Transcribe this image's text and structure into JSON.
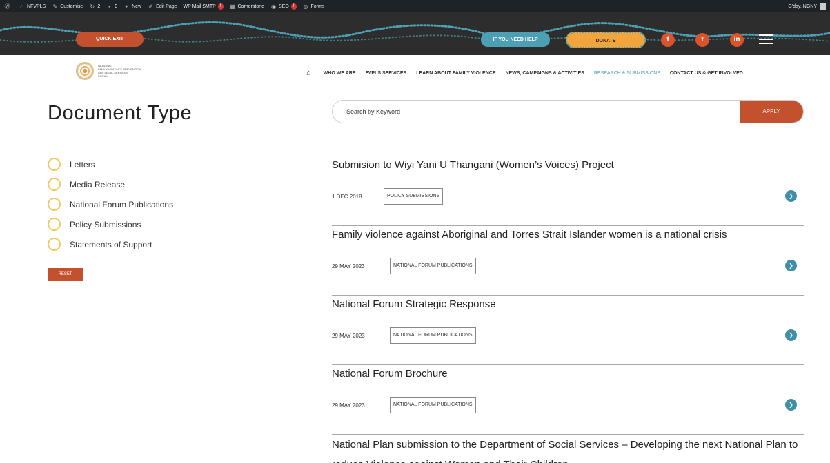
{
  "adminbar": {
    "items": [
      {
        "icon": "wordpress-icon",
        "label": ""
      },
      {
        "icon": "home-icon",
        "label": "NFVPLS"
      },
      {
        "icon": "brush-icon",
        "label": "Customise"
      },
      {
        "icon": "refresh-icon",
        "label": "2"
      },
      {
        "icon": "comment-icon",
        "label": "0"
      },
      {
        "icon": "plus-icon",
        "label": "New"
      },
      {
        "icon": "pencil-icon",
        "label": "Edit Page"
      },
      {
        "icon": "mail-icon",
        "label": "WP Mail SMTP",
        "badge": "!"
      },
      {
        "icon": "cornerstone-icon",
        "label": "Cornerstone"
      },
      {
        "icon": "seo-icon",
        "label": "SEO",
        "badge": "!"
      },
      {
        "icon": "forms-icon",
        "label": "Forms"
      }
    ],
    "greeting": "G'day, NGNY"
  },
  "header": {
    "quick_exit": "QUICK EXIT",
    "help": "IF YOU NEED HELP",
    "donate": "DONATE",
    "social": [
      "f",
      "t",
      "in"
    ]
  },
  "logo": {
    "line1": "NATIONAL",
    "line2": "FAMILY VIOLENCE PREVENTION",
    "line3": "AND LEGAL SERVICES",
    "line4": "FORUM"
  },
  "nav": {
    "items": [
      {
        "label": "WHO WE ARE",
        "active": false
      },
      {
        "label": "FVPLS SERVICES",
        "active": false
      },
      {
        "label": "LEARN ABOUT FAMILY VIOLENCE",
        "active": false
      },
      {
        "label": "NEWS, CAMPAIGNS & ACTIVITIES",
        "active": false
      },
      {
        "label": "RESEARCH & SUBMISSIONS",
        "active": true
      },
      {
        "label": "CONTACT US & GET INVOLVED",
        "active": false
      }
    ]
  },
  "sidebar": {
    "heading": "Document Type",
    "filters": [
      "Letters",
      "Media Release",
      "National Forum Publications",
      "Policy Submissions",
      "Statements of Support"
    ],
    "reset": "RESET"
  },
  "search": {
    "placeholder": "Search by Keyword",
    "apply": "APPLY"
  },
  "results": [
    {
      "title": "Submision to Wiyi Yani U Thangani (Women’s Voices) Project",
      "date": "1 DEC 2018",
      "tag": "POLICY SUBMISSIONS"
    },
    {
      "title": "Family violence against Aboriginal and Torres Strait Islander women is a national crisis",
      "date": "29 MAY 2023",
      "tag": "NATIONAL FORUM PUBLICATIONS"
    },
    {
      "title": "National Forum Strategic Response",
      "date": "29 MAY 2023",
      "tag": "NATIONAL FORUM PUBLICATIONS"
    },
    {
      "title": "National Forum Brochure",
      "date": "29 MAY 2023",
      "tag": "NATIONAL FORUM PUBLICATIONS"
    },
    {
      "title": "National Plan submission to the Department of Social Services – Developing the next National Plan to reduce Violence against Women and Their Children"
    }
  ],
  "colors": {
    "accent": "#c4512e",
    "teal": "#4d9fb4",
    "orange": "#f2a53c",
    "dark": "#2d2d2d",
    "radio_border": "#f3ca5e"
  }
}
